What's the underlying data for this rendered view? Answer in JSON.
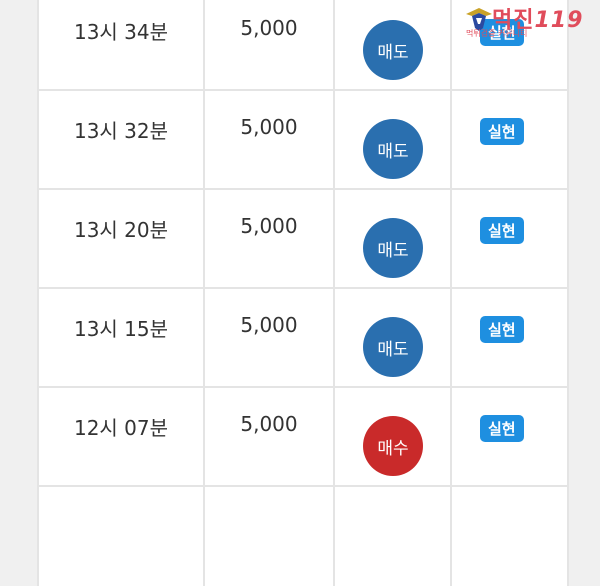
{
  "colors": {
    "sell": "#2a6faf",
    "buy": "#c92a2a",
    "status_badge": "#1e8fe0"
  },
  "trades": [
    {
      "time": "13시 34분",
      "amount": "5,000",
      "type": "매도",
      "type_kind": "sell",
      "status": "실현"
    },
    {
      "time": "13시 32분",
      "amount": "5,000",
      "type": "매도",
      "type_kind": "sell",
      "status": "실현"
    },
    {
      "time": "13시 20분",
      "amount": "5,000",
      "type": "매도",
      "type_kind": "sell",
      "status": "실현"
    },
    {
      "time": "13시 15분",
      "amount": "5,000",
      "type": "매도",
      "type_kind": "sell",
      "status": "실현"
    },
    {
      "time": "12시 07분",
      "amount": "5,000",
      "type": "매수",
      "type_kind": "buy",
      "status": "실현"
    }
  ],
  "watermark": {
    "title": "먹진",
    "suffix": "119",
    "tagline": "먹튀검증 커뮤니티",
    "icon": "eagle-emblem-icon"
  }
}
